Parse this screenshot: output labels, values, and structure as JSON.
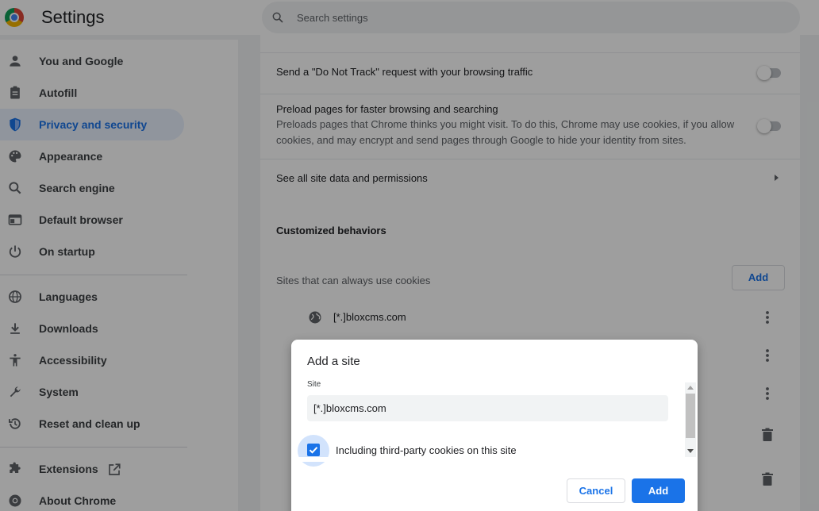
{
  "header": {
    "title": "Settings",
    "search_placeholder": "Search settings"
  },
  "sidebar": {
    "items": [
      {
        "label": "You and Google",
        "icon": "person-icon"
      },
      {
        "label": "Autofill",
        "icon": "clipboard-icon"
      },
      {
        "label": "Privacy and security",
        "icon": "shield-icon",
        "active": true
      },
      {
        "label": "Appearance",
        "icon": "palette-icon"
      },
      {
        "label": "Search engine",
        "icon": "search-icon"
      },
      {
        "label": "Default browser",
        "icon": "browser-icon"
      },
      {
        "label": "On startup",
        "icon": "power-icon"
      },
      {
        "label": "Languages",
        "icon": "globe-icon"
      },
      {
        "label": "Downloads",
        "icon": "download-icon"
      },
      {
        "label": "Accessibility",
        "icon": "accessibility-icon"
      },
      {
        "label": "System",
        "icon": "wrench-icon"
      },
      {
        "label": "Reset and clean up",
        "icon": "history-icon"
      },
      {
        "label": "Extensions",
        "icon": "puzzle-icon"
      },
      {
        "label": "About Chrome",
        "icon": "chrome-icon"
      }
    ]
  },
  "main": {
    "dnt": {
      "label": "Send a \"Do Not Track\" request with your browsing traffic",
      "enabled": false
    },
    "preload": {
      "label": "Preload pages for faster browsing and searching",
      "sub": "Preloads pages that Chrome thinks you might visit. To do this, Chrome may use cookies, if you allow cookies, and may encrypt and send pages through Google to hide your identity from sites.",
      "enabled": false
    },
    "site_data_link": "See all site data and permissions",
    "customized_title": "Customized behaviors",
    "allow_title": "Sites that can always use cookies",
    "add_label": "Add",
    "sites": [
      "[*.]bloxcms.com"
    ]
  },
  "dialog": {
    "title": "Add a site",
    "field_label": "Site",
    "site_value": "[*.]bloxcms.com",
    "checkbox_label": "Including third-party cookies on this site",
    "checkbox_checked": true,
    "cancel_label": "Cancel",
    "add_label": "Add"
  },
  "colors": {
    "accent": "#1a73e8",
    "active_bg": "#e8f0fe"
  }
}
